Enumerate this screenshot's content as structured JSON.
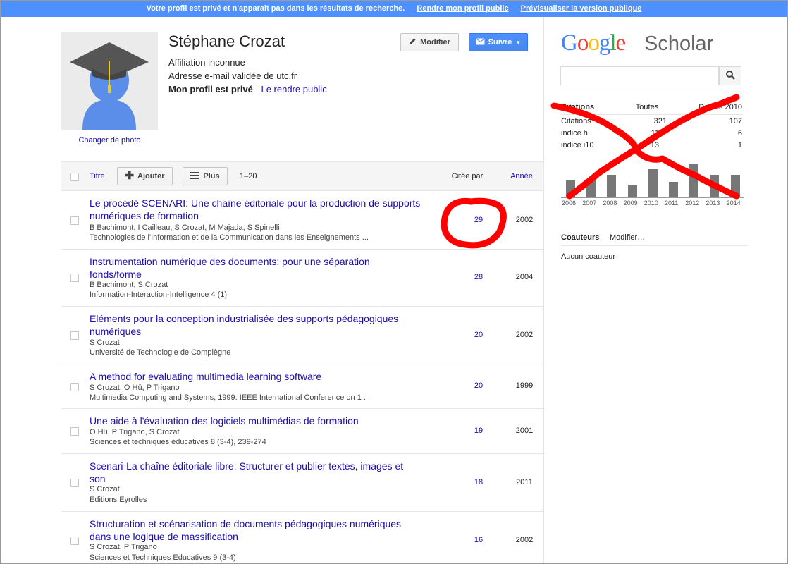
{
  "banner": {
    "message": "Votre profil est privé et n'apparaît pas dans les résultats de recherche.",
    "link_public": "Rendre mon profil public",
    "link_preview": "Prévisualiser la version publique"
  },
  "profile": {
    "name": "Stéphane Crozat",
    "affiliation": "Affiliation inconnue",
    "email": "Adresse e-mail validée de utc.fr",
    "private_label": "Mon profil est privé",
    "private_sep": " - ",
    "make_public": "Le rendre public",
    "change_photo": "Changer de photo",
    "edit_button": "Modifier",
    "follow_button": "Suivre"
  },
  "list_header": {
    "title": "Titre",
    "add": "Ajouter",
    "more": "Plus",
    "range": "1–20",
    "cited_by": "Citée par",
    "year": "Année"
  },
  "articles": [
    {
      "title": "Le procédé SCENARI: Une chaîne éditoriale pour la production de supports numériques de formation",
      "authors": "B Bachimont, I Cailleau, S Crozat, M Majada, S Spinelli",
      "venue": "Technologies de l'Information et de la Communication dans les Enseignements ...",
      "cited": "29",
      "year": "2002"
    },
    {
      "title": "Instrumentation numérique des documents: pour une séparation fonds/forme",
      "authors": "B Bachimont, S Crozat",
      "venue": "Information-Interaction-Intelligence 4 (1)",
      "cited": "28",
      "year": "2004"
    },
    {
      "title": "Eléments pour la conception industrialisée des supports pédagogiques numériques",
      "authors": "S Crozat",
      "venue": "Université de Technologie de Compiègne",
      "cited": "20",
      "year": "2002"
    },
    {
      "title": "A method for evaluating multimedia learning software",
      "authors": "S Crozat, O Hû, P Trigano",
      "venue": "Multimedia Computing and Systems, 1999. IEEE International Conference on 1 ...",
      "cited": "20",
      "year": "1999"
    },
    {
      "title": "Une aide à l'évaluation des logiciels multimédias de formation",
      "authors": "O Hû, P Trigano, S Crozat",
      "venue": "Sciences et techniques éducatives 8 (3-4), 239-274",
      "cited": "19",
      "year": "2001"
    },
    {
      "title": "Scenari-La chaîne éditoriale libre: Structurer et publier textes, images et son",
      "authors": "S Crozat",
      "venue": "Editions Eyrolles",
      "cited": "18",
      "year": "2011"
    },
    {
      "title": "Structuration et scénarisation de documents pédagogiques numériques dans une logique de massification",
      "authors": "S Crozat, P Trigano",
      "venue": "Sciences et Techniques Educatives 9 (3-4)",
      "cited": "16",
      "year": "2002"
    }
  ],
  "sidebar": {
    "logo_google": "Google",
    "logo_scholar": "Scholar",
    "search_value": "",
    "stats_header": {
      "label": "Citations",
      "all": "Toutes",
      "since": "Depuis 2010"
    },
    "stats": [
      {
        "label": "Citations",
        "all": "321",
        "since": "107"
      },
      {
        "label": "indice h",
        "all": "11",
        "since": "6"
      },
      {
        "label": "indice i10",
        "all": "13",
        "since": "1"
      }
    ],
    "coauthors_title": "Coauteurs",
    "coauthors_edit": "Modifier…",
    "coauthors_none": "Aucun coauteur"
  },
  "chart_data": {
    "type": "bar",
    "categories": [
      "2006",
      "2007",
      "2008",
      "2009",
      "2010",
      "2011",
      "2012",
      "2013",
      "2014"
    ],
    "values": [
      12,
      13,
      16,
      9,
      20,
      11,
      24,
      16,
      16
    ],
    "ylim": [
      0,
      25
    ]
  },
  "colors": {
    "banner": "#4d90fe",
    "link": "#1a0dab",
    "bar": "#777777",
    "scribble": "#ff0000"
  }
}
